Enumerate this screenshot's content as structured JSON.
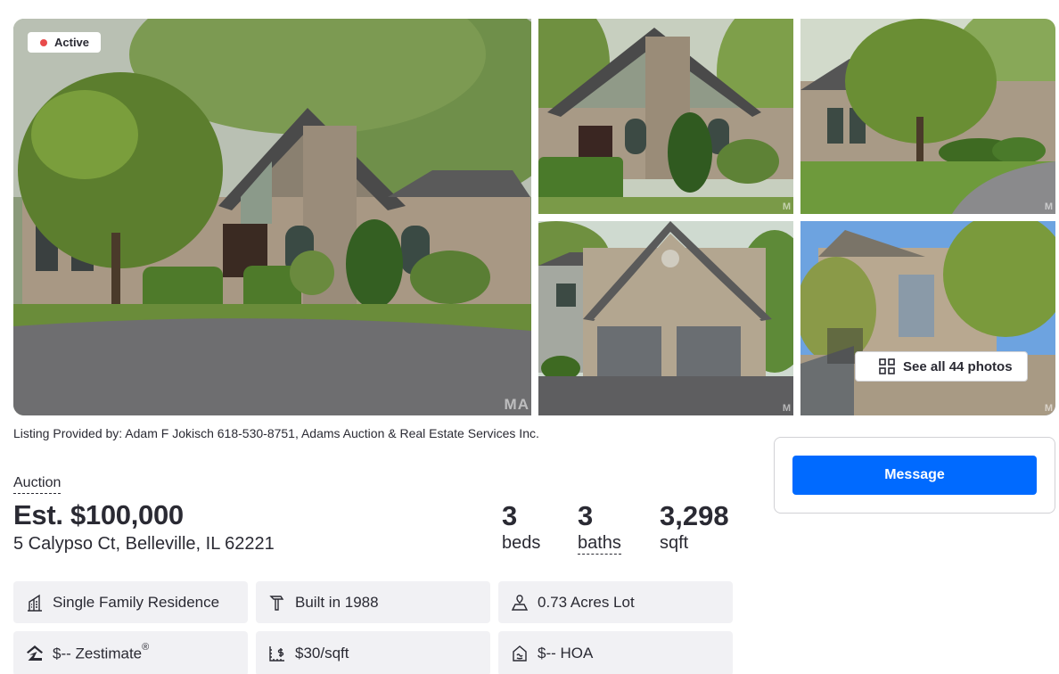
{
  "gallery": {
    "status_badge": "Active",
    "watermark": "MA",
    "watermark_small": "M",
    "see_all_label": "See all 44 photos",
    "photos": [
      "front-exterior",
      "front-entry",
      "side-yard",
      "garage",
      "backyard-patio"
    ]
  },
  "listing": {
    "provided_by": "Listing Provided by: Adam F Jokisch 618-530-8751, Adams Auction & Real Estate Services Inc.",
    "type": "Auction",
    "price": "Est. $100,000",
    "address": "5 Calypso Ct, Belleville, IL 62221",
    "beds": {
      "value": "3",
      "label": "beds"
    },
    "baths": {
      "value": "3",
      "label": "baths"
    },
    "sqft": {
      "value": "3,298",
      "label": "sqft"
    }
  },
  "facts": {
    "home_type": "Single Family Residence",
    "year_built": "Built in 1988",
    "lot": "0.73 Acres Lot",
    "zestimate": "$-- Zestimate",
    "zestimate_mark": "®",
    "price_per_sqft": "$30/sqft",
    "hoa": "$-- HOA"
  },
  "contact": {
    "message_label": "Message"
  },
  "colors": {
    "accent": "#006aff",
    "status_active": "#e84b4b",
    "fact_bg": "#f1f1f4",
    "text": "#2a2a33"
  },
  "icons": [
    "building-icon",
    "hammer-icon",
    "lot-size-icon",
    "zestimate-icon",
    "price-per-sqft-icon",
    "hoa-icon",
    "grid-icon",
    "status-dot"
  ]
}
